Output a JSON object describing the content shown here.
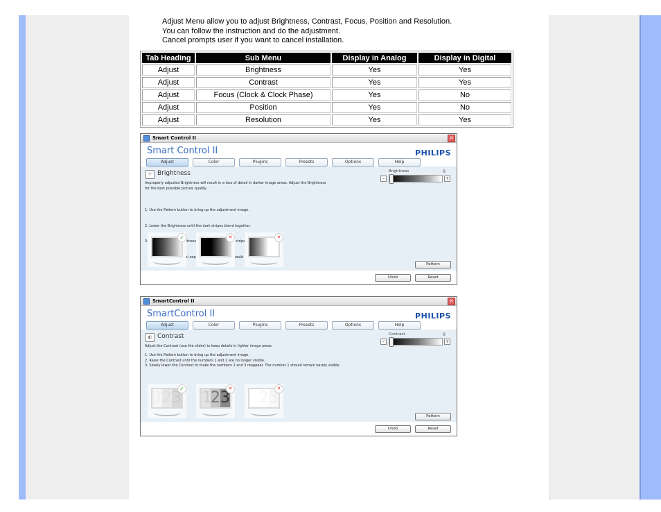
{
  "intro": [
    "Adjust Menu allow you to adjust Brightness, Contrast, Focus, Position and Resolution.",
    "You can follow the instruction and do the adjustment.",
    "Cancel prompts user if you want to cancel installation."
  ],
  "table": {
    "headers": [
      "Tab Heading",
      "Sub Menu",
      "Display in Analog",
      "Display in Digital"
    ],
    "rows": [
      [
        "Adjust",
        "Brightness",
        "Yes",
        "Yes"
      ],
      [
        "Adjust",
        "Contrast",
        "Yes",
        "Yes"
      ],
      [
        "Adjust",
        "Focus (Clock & Clock Phase)",
        "Yes",
        "No"
      ],
      [
        "Adjust",
        "Position",
        "Yes",
        "No"
      ],
      [
        "Adjust",
        "Resolution",
        "Yes",
        "Yes"
      ]
    ]
  },
  "win1": {
    "window_title": "Smart Control II",
    "app_title": "Smart Control II",
    "logo": "PHILIPS",
    "tabs": [
      "Adjust",
      "Color",
      "Plugins",
      "Presets",
      "Options",
      "Help"
    ],
    "active_tab": "Adjust",
    "section_title": "Brightness",
    "description": [
      "Improperly adjusted Brightness will result in a loss of detail in darker image areas. Adjust the Brightness",
      "for the best possible picture quality."
    ],
    "steps": [
      "1. Use the Pattern button to bring up the adjustment image.",
      "2. Lower the Brightness until the dark stripes blend together.",
      "3. Slowly raise the Brightness until each of the dark stripes become visible.",
      "   Try to achieve an equal separation. The darkest should always remain black."
    ],
    "slider": {
      "label": "Brightness",
      "value": "0",
      "minus": "-",
      "plus": "+",
      "position": 0.0
    },
    "examples": [
      "correct",
      "wrong",
      "wrong"
    ],
    "buttons": {
      "pattern": "Pattern",
      "undo": "Undo",
      "reset": "Reset"
    }
  },
  "win2": {
    "window_title": "SmartControl II",
    "app_title": "SmartControl II",
    "logo": "PHILIPS",
    "tabs": [
      "Adjust",
      "Color",
      "Plugins",
      "Presets",
      "Options",
      "Help"
    ],
    "active_tab": "Adjust",
    "section_title": "Contrast",
    "description": [
      "Adjust the Contrast (use the slider) to keep details in lighter image areas."
    ],
    "steps": [
      "1. Use the Pattern button to bring up the adjustment image.",
      "2. Raise the Contrast until the numbers 1 and 2 are no longer visible.",
      "3. Slowly lower the Contrast to make the numbers 2 and 3 reappear. The number 1 should remain barely visible."
    ],
    "slider": {
      "label": "Contrast",
      "value": "0",
      "minus": "-",
      "plus": "+",
      "position": 0.0
    },
    "examples": [
      "correct",
      "wrong",
      "wrong"
    ],
    "digits": [
      "1",
      "2",
      "3"
    ],
    "buttons": {
      "pattern": "Pattern",
      "undo": "Undo",
      "reset": "Reset"
    }
  },
  "icons": {
    "check": "✓",
    "cross": "✕",
    "close": "✕",
    "sun": "☼",
    "contrast": "◐"
  }
}
